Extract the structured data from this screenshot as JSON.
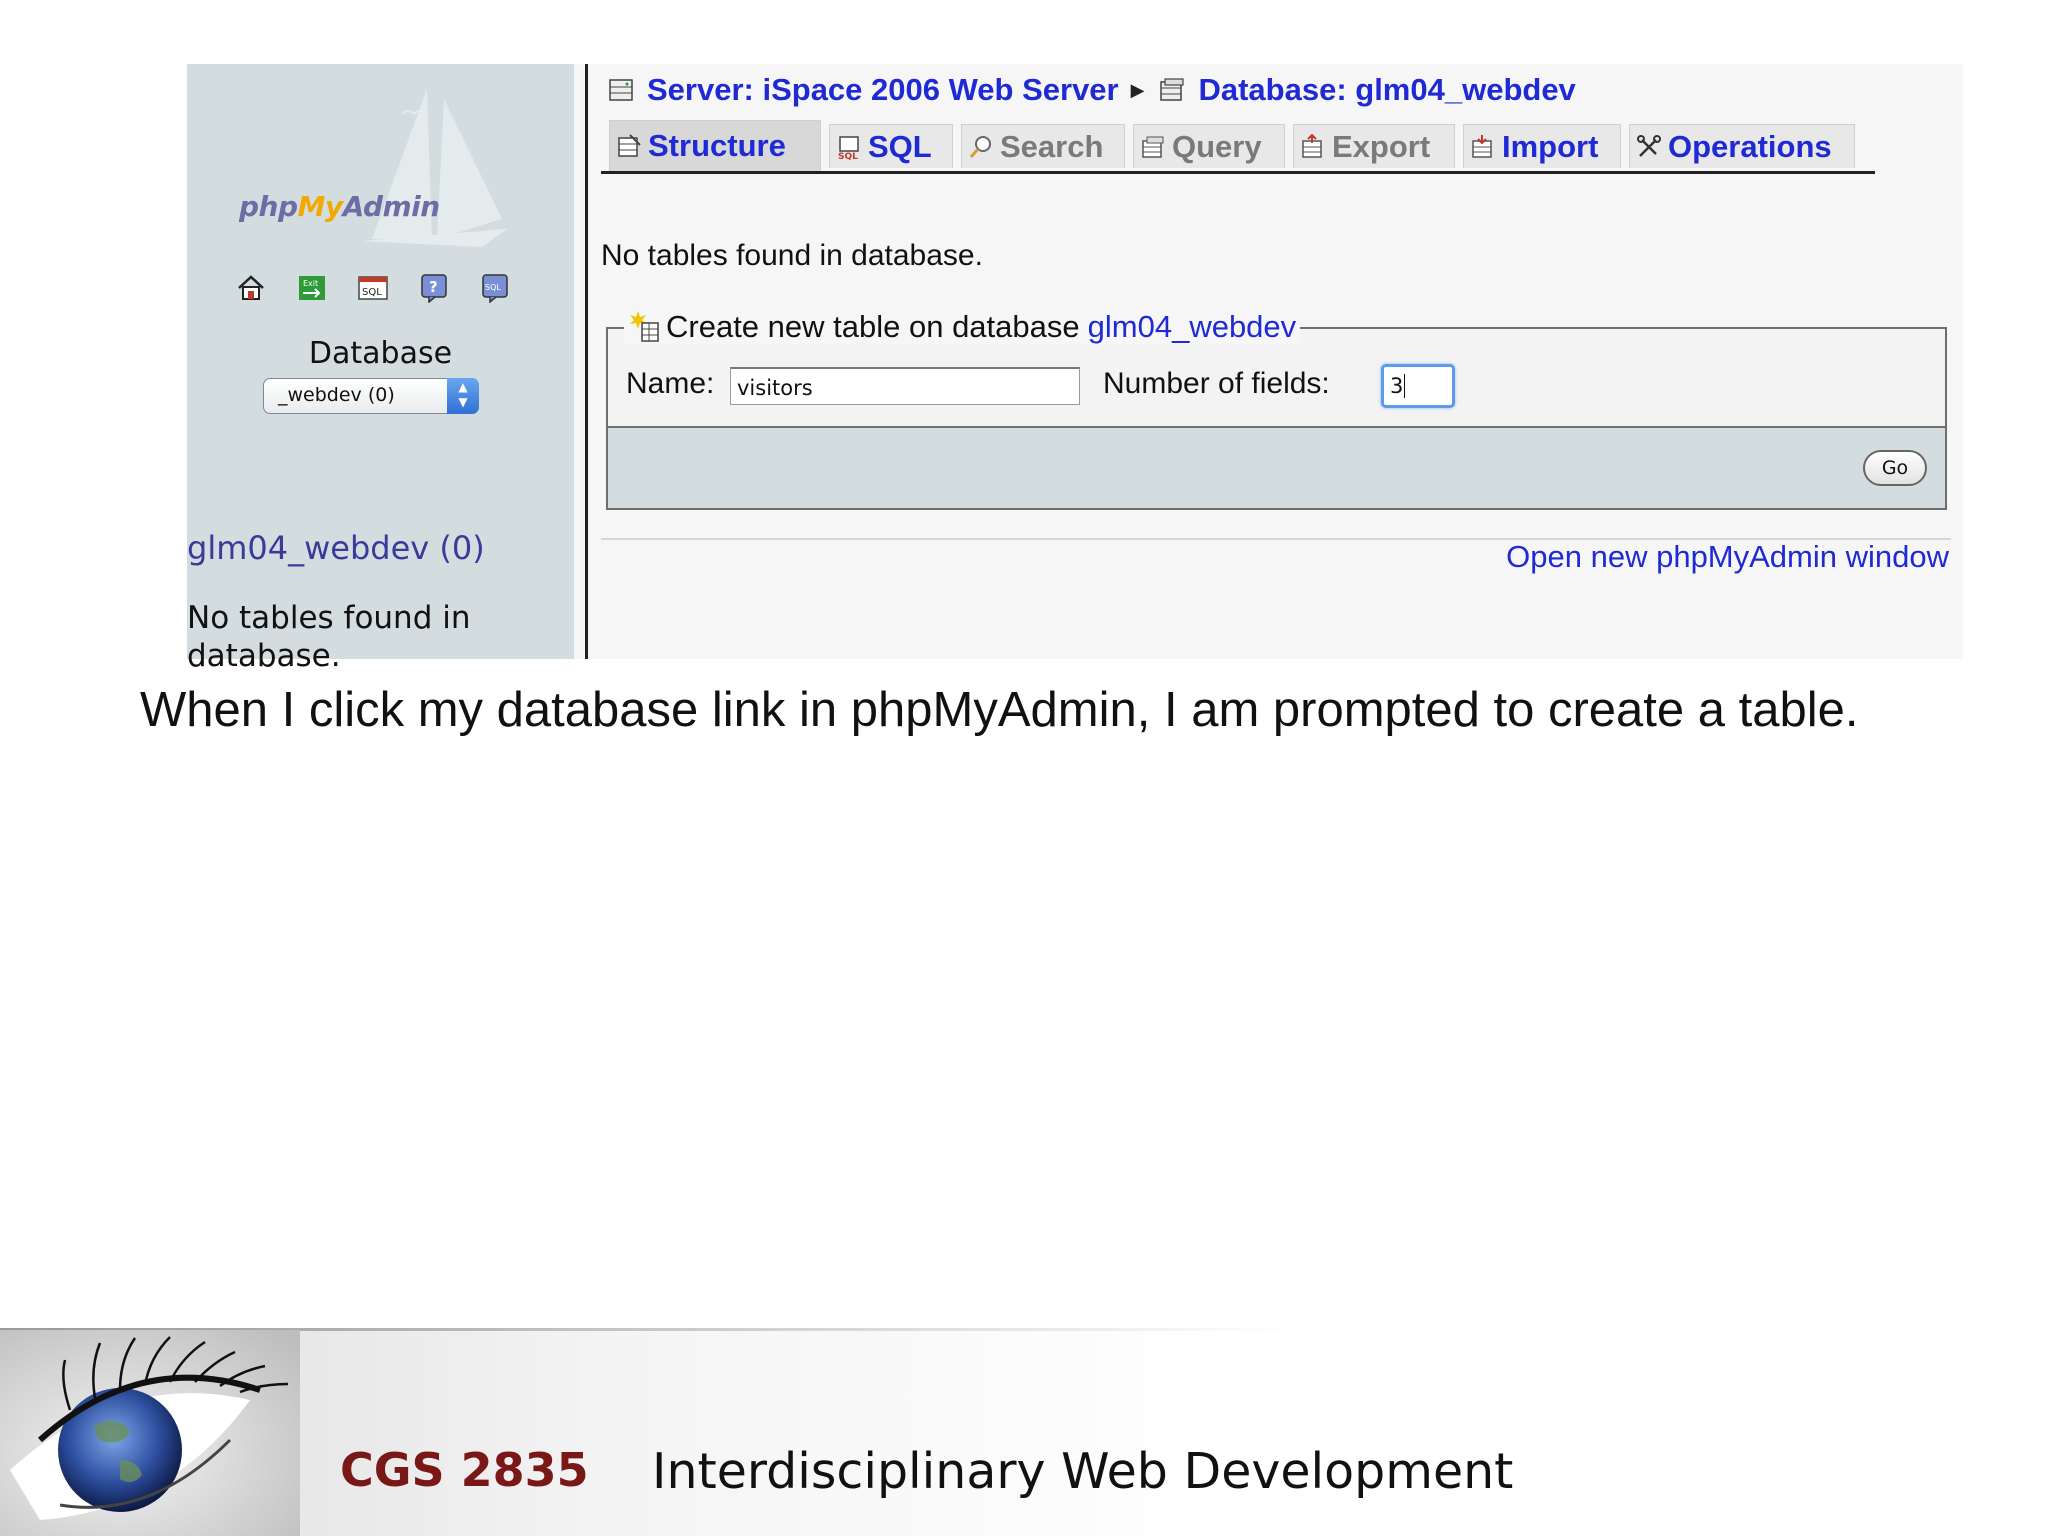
{
  "sidebar": {
    "logo": {
      "php": "php",
      "my": "My",
      "admin": "Admin"
    },
    "nav_icons": [
      "home-icon",
      "exit-icon",
      "sql-query-icon",
      "help-icon",
      "sql-docs-icon"
    ],
    "database_label": "Database",
    "database_select_value": "_webdev (0)",
    "database_link": "glm04_webdev (0)",
    "no_tables_message": "No tables found in database."
  },
  "breadcrumb": {
    "server": "Server: iSpace 2006 Web Server",
    "database": "Database: glm04_webdev"
  },
  "tabs": [
    {
      "label": "Structure",
      "icon": "structure-icon",
      "active": true
    },
    {
      "label": "SQL",
      "icon": "sql-icon",
      "active": false
    },
    {
      "label": "Search",
      "icon": "search-icon",
      "active": false
    },
    {
      "label": "Query",
      "icon": "query-icon",
      "active": false
    },
    {
      "label": "Export",
      "icon": "export-icon",
      "active": false
    },
    {
      "label": "Import",
      "icon": "import-icon",
      "active": false
    },
    {
      "label": "Operations",
      "icon": "operations-icon",
      "active": false
    }
  ],
  "main": {
    "no_tables": "No tables found in database.",
    "create_table": {
      "legend_prefix": "Create new table on database",
      "legend_db": "glm04_webdev",
      "name_label": "Name:",
      "name_value": "visitors",
      "fields_label": "Number of fields:",
      "fields_value": "3",
      "go_label": "Go"
    },
    "open_new_window": "Open new phpMyAdmin window"
  },
  "slide": {
    "caption": "When I click my database link in phpMyAdmin, I am prompted to create a table.",
    "course_code": "CGS 2835",
    "course_name": "Interdisciplinary Web Development"
  },
  "colors": {
    "link_blue": "#1f2ad4",
    "sidebar_bg": "#d3dde0",
    "course_code": "#7a1818"
  }
}
